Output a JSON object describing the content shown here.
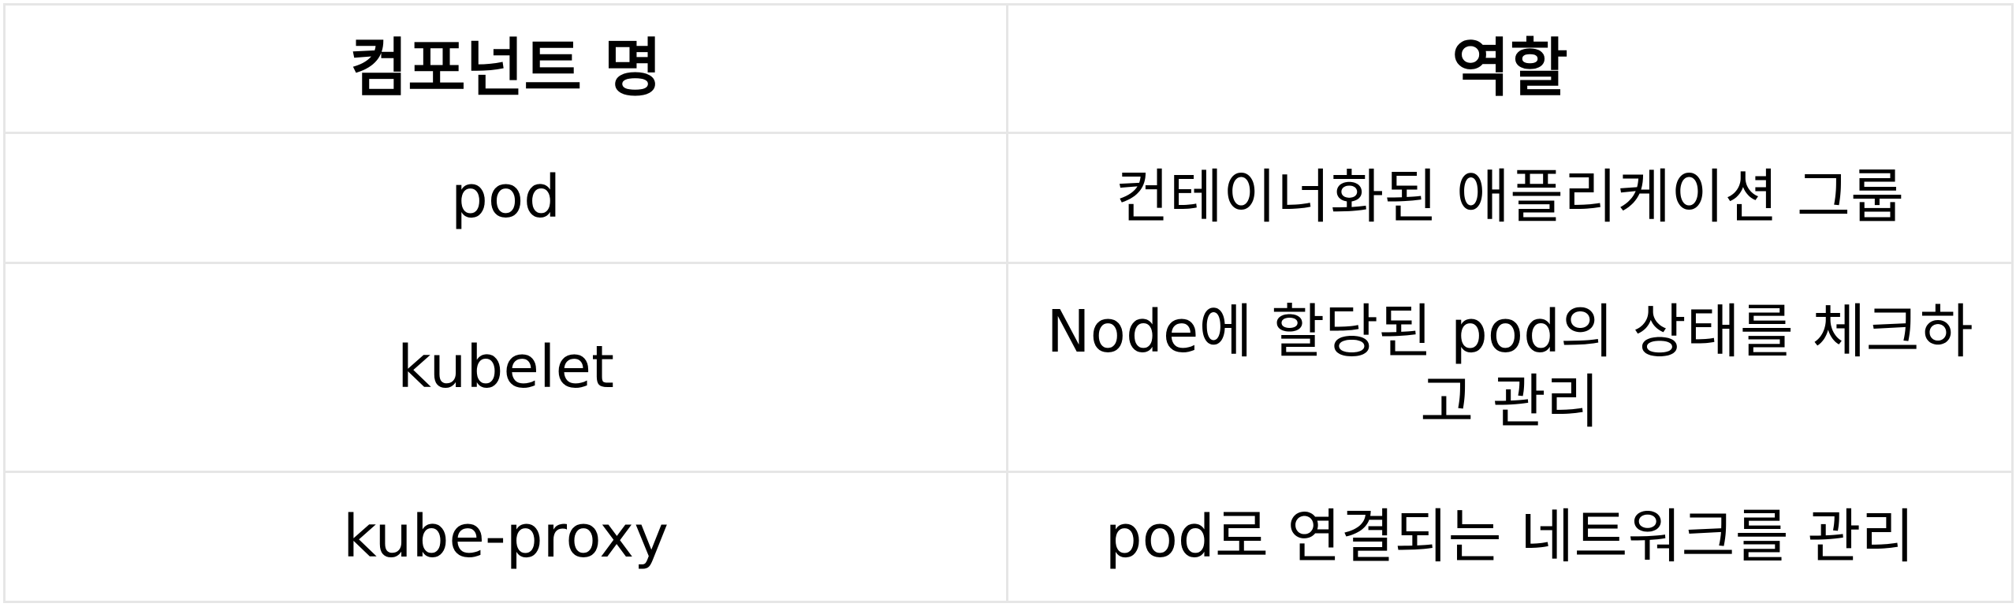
{
  "table": {
    "headers": [
      "컴포넌트 명",
      "역할"
    ],
    "rows": [
      {
        "component": "pod",
        "role": "컨테이너화된 애플리케이션 그룹"
      },
      {
        "component": "kubelet",
        "role": "Node에 할당된 pod의 상태를 체크하고 관리"
      },
      {
        "component": "kube-proxy",
        "role": "pod로 연결되는 네트워크를 관리"
      }
    ]
  },
  "colors": {
    "border": "#e6e6e6",
    "text": "#000000",
    "background": "#ffffff"
  }
}
